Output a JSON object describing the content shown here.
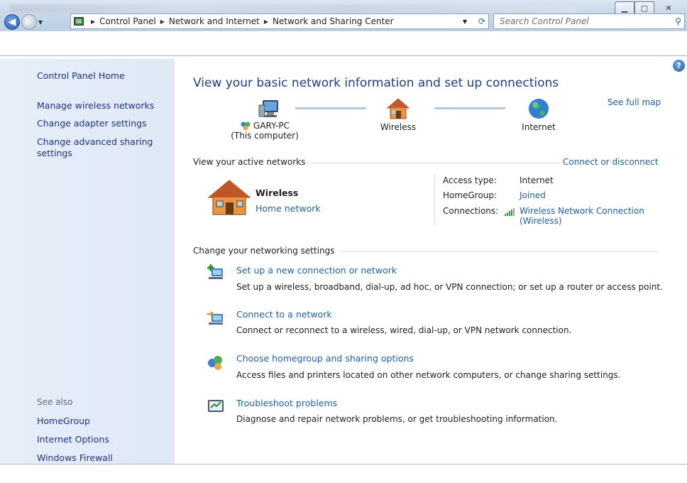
{
  "window": {
    "address_crumbs": [
      "Control Panel",
      "Network and Internet",
      "Network and Sharing Center"
    ],
    "search_placeholder": "Search Control Panel"
  },
  "sidebar": {
    "home": "Control Panel Home",
    "links": [
      "Manage wireless networks",
      "Change adapter settings",
      "Change advanced sharing settings"
    ],
    "see_also_label": "See also",
    "see_also": [
      "HomeGroup",
      "Internet Options",
      "Windows Firewall"
    ]
  },
  "main": {
    "title": "View your basic network information and set up connections",
    "see_full_map": "See full map",
    "map": {
      "computer_name": "GARY-PC",
      "computer_sub": "(This computer)",
      "network": "Wireless",
      "internet": "Internet"
    },
    "active_header": "View your active networks",
    "connect_link": "Connect or disconnect",
    "network": {
      "name": "Wireless",
      "type": "Home network"
    },
    "details": {
      "access_type_label": "Access type:",
      "access_type": "Internet",
      "homegroup_label": "HomeGroup:",
      "homegroup": "Joined",
      "connections_label": "Connections:",
      "connection_line1": "Wireless Network Connection",
      "connection_line2": "(Wireless)"
    },
    "settings_header": "Change your networking settings",
    "tasks": [
      {
        "title": "Set up a new connection or network",
        "desc": "Set up a wireless, broadband, dial-up, ad hoc, or VPN connection; or set up a router or access point."
      },
      {
        "title": "Connect to a network",
        "desc": "Connect or reconnect to a wireless, wired, dial-up, or VPN network connection."
      },
      {
        "title": "Choose homegroup and sharing options",
        "desc": "Access files and printers located on other network computers, or change sharing settings."
      },
      {
        "title": "Troubleshoot problems",
        "desc": "Diagnose and repair network problems, or get troubleshooting information."
      }
    ]
  },
  "colors": {
    "link": "#1c5fb8",
    "title": "#1e3c8c",
    "sidebar_bg": "#e2ebf8"
  }
}
